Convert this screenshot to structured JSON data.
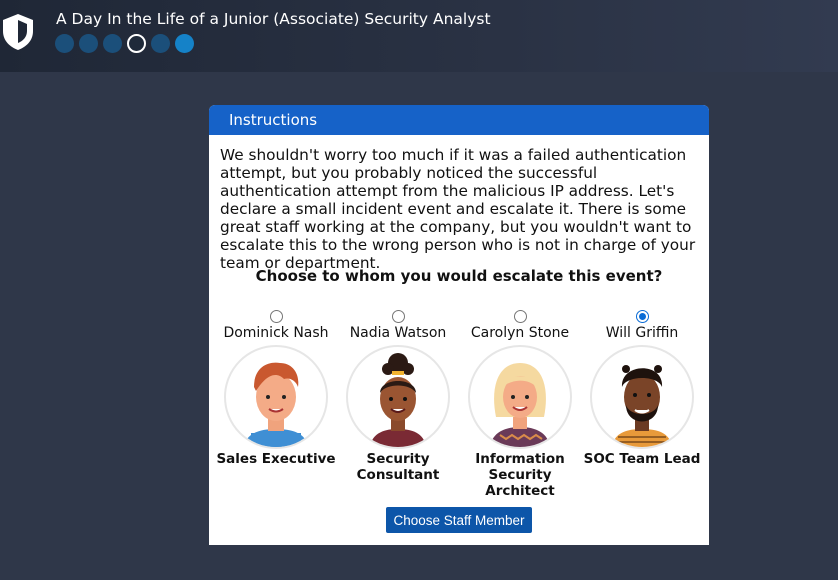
{
  "header": {
    "title": "A Day In the Life of a Junior (Associate) Security Analyst",
    "progress": {
      "steps": 6,
      "current_step": 4,
      "completed_steps": [
        1,
        2,
        3
      ]
    }
  },
  "card": {
    "header_label": "Instructions",
    "body": "We shouldn't worry too much if it was a failed authentication attempt, but you probably noticed the successful authentication attempt from the malicious IP address. Let's declare a small incident event and escalate it. There is some great staff working at the company, but you wouldn't want to escalate this to the wrong person who is not in charge of your team or department.",
    "question": "Choose to whom you would escalate this event?",
    "staff": [
      {
        "name": "Dominick Nash",
        "role": "Sales Executive",
        "selected": false
      },
      {
        "name": "Nadia Watson",
        "role": "Security Consultant",
        "selected": false
      },
      {
        "name": "Carolyn Stone",
        "role": "Information Security Architect",
        "selected": false
      },
      {
        "name": "Will Griffin",
        "role": "SOC Team Lead",
        "selected": true
      }
    ],
    "button_label": "Choose Staff Member"
  },
  "colors": {
    "background": "#2f3749",
    "header_accent": "#1662c8",
    "button": "#0d56a9",
    "radio_selected": "#0a6cd6"
  }
}
